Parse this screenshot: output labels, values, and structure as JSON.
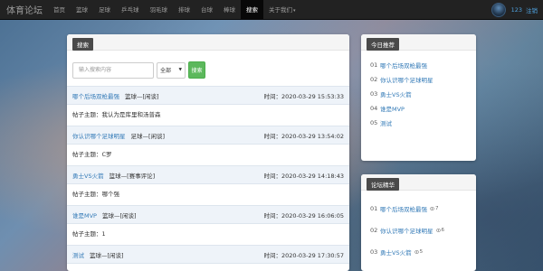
{
  "nav": {
    "brand": "体育论坛",
    "items": [
      {
        "label": "首页"
      },
      {
        "label": "篮球"
      },
      {
        "label": "足球"
      },
      {
        "label": "乒乓球"
      },
      {
        "label": "羽毛球"
      },
      {
        "label": "排球"
      },
      {
        "label": "台球"
      },
      {
        "label": "棒球"
      },
      {
        "label": "搜索"
      },
      {
        "label": "关于我们"
      }
    ],
    "user": "123",
    "logout": "注销"
  },
  "main": {
    "title": "搜索",
    "search": {
      "placeholder": "输入搜索内容",
      "select_value": "全部",
      "button_label": "搜索"
    },
    "posts": [
      {
        "title": "哪个后场双枪最强",
        "category": "篮球—[闲谈]",
        "time": "时间：2020-03-29 15:53:33",
        "content": "帖子主题：我认为是库里和汤普森"
      },
      {
        "title": "你认识哪个足球明星",
        "category": "足球—[闲谈]",
        "time": "时间：2020-03-29 13:54:02",
        "content": "帖子主题：C罗"
      },
      {
        "title": "勇士VS火箭",
        "category": "篮球—[赛事评论]",
        "time": "时间：2020-03-29 14:18:43",
        "content": "帖子主题：哪个强"
      },
      {
        "title": "谁是MVP",
        "category": "篮球—[闲谈]",
        "time": "时间：2020-03-29 16:06:05",
        "content": "帖子主题：1"
      },
      {
        "title": "测试",
        "category": "篮球—[闲谈]",
        "time": "时间：2020-03-29 17:30:57",
        "content": ""
      }
    ]
  },
  "recommend": {
    "title": "今日推荐",
    "items": [
      {
        "num": "01",
        "label": "哪个后场双枪最强"
      },
      {
        "num": "02",
        "label": "你认识哪个足球明星"
      },
      {
        "num": "03",
        "label": "勇士VS火箭"
      },
      {
        "num": "04",
        "label": "谁是MVP"
      },
      {
        "num": "05",
        "label": "测试"
      }
    ]
  },
  "hot": {
    "title": "论坛精华",
    "items": [
      {
        "num": "01",
        "label": "哪个后场双枪最强",
        "views": "7"
      },
      {
        "num": "02",
        "label": "你认识哪个足球明星",
        "views": "6"
      },
      {
        "num": "03",
        "label": "勇士VS火箭",
        "views": "5"
      }
    ]
  },
  "colors": {
    "navbar": "#222222",
    "link": "#337ab7",
    "search_button": "#5cb85c",
    "row_highlight": "#eef3f9"
  }
}
